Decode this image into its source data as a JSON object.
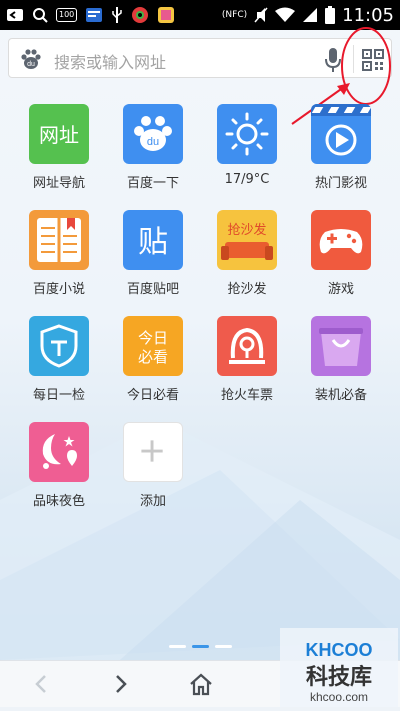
{
  "status_bar": {
    "left_icons": [
      "notification-icon",
      "search-icon",
      "battery-100-icon",
      "news-icon",
      "usb-icon",
      "app-icon",
      "gallery-icon"
    ],
    "battery_badge": "100",
    "nfc_label": "(NFC)",
    "time": "11:05"
  },
  "search": {
    "placeholder": "搜索或输入网址"
  },
  "tiles": [
    {
      "label": "网址导航",
      "icon": "wangzhi-icon",
      "color": "#55c14f",
      "glyph": "网址"
    },
    {
      "label": "百度一下",
      "icon": "baidu-paw-icon",
      "color": "#3f8ff0"
    },
    {
      "label": "17/9°C",
      "icon": "weather-sun-icon",
      "color": "#3f8ff0"
    },
    {
      "label": "热门影视",
      "icon": "video-play-icon",
      "color": "#3f8ff0"
    },
    {
      "label": "百度小说",
      "icon": "book-icon",
      "color": "#f39a3b"
    },
    {
      "label": "百度贴吧",
      "icon": "tieba-icon",
      "color": "#3f8ff0",
      "glyph": "贴"
    },
    {
      "label": "抢沙发",
      "icon": "sofa-icon",
      "color": "#f6c33e",
      "glyph": "抢沙发"
    },
    {
      "label": "游戏",
      "icon": "gamepad-icon",
      "color": "#f05a3e"
    },
    {
      "label": "每日一检",
      "icon": "shield-icon",
      "color": "#35a8e0"
    },
    {
      "label": "今日必看",
      "icon": "today-icon",
      "color": "#f6a623",
      "glyph": "今日必看"
    },
    {
      "label": "抢火车票",
      "icon": "train-ticket-icon",
      "color": "#ef5b4c"
    },
    {
      "label": "装机必备",
      "icon": "shopping-bag-icon",
      "color": "#b673e0"
    },
    {
      "label": "品味夜色",
      "icon": "moon-heart-icon",
      "color": "#ef5e93"
    },
    {
      "label": "添加",
      "icon": "plus-icon",
      "color": "#ffffff"
    }
  ],
  "pager": {
    "count": 3,
    "active": 1
  },
  "toolbar": {
    "buttons": [
      "back-icon",
      "forward-icon",
      "home-icon"
    ]
  },
  "watermark": {
    "brand": "KHCOO",
    "chinese": "科技库",
    "url": "khcoo.com"
  },
  "colors": {
    "accent": "#3b95e8",
    "annotation": "#e8192c"
  }
}
